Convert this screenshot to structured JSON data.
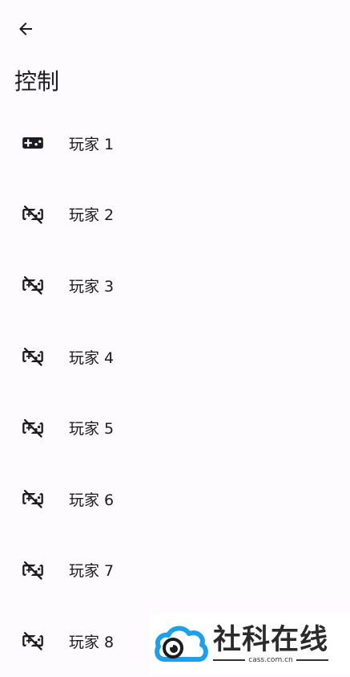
{
  "header": {
    "back_icon": "arrow-back-icon",
    "title": "控制"
  },
  "players": [
    {
      "label": "玩家 1",
      "icon": "gamepad-icon",
      "connected": true
    },
    {
      "label": "玩家 2",
      "icon": "gamepad-off-icon",
      "connected": false
    },
    {
      "label": "玩家 3",
      "icon": "gamepad-off-icon",
      "connected": false
    },
    {
      "label": "玩家 4",
      "icon": "gamepad-off-icon",
      "connected": false
    },
    {
      "label": "玩家 5",
      "icon": "gamepad-off-icon",
      "connected": false
    },
    {
      "label": "玩家 6",
      "icon": "gamepad-off-icon",
      "connected": false
    },
    {
      "label": "玩家 7",
      "icon": "gamepad-off-icon",
      "connected": false
    },
    {
      "label": "玩家 8",
      "icon": "gamepad-off-icon",
      "connected": false
    }
  ],
  "watermark": {
    "title": "社科在线",
    "subtitle": "cass.com.cn",
    "colors": {
      "cloud": "#1ea0e8",
      "text": "#2b2b2b"
    }
  }
}
